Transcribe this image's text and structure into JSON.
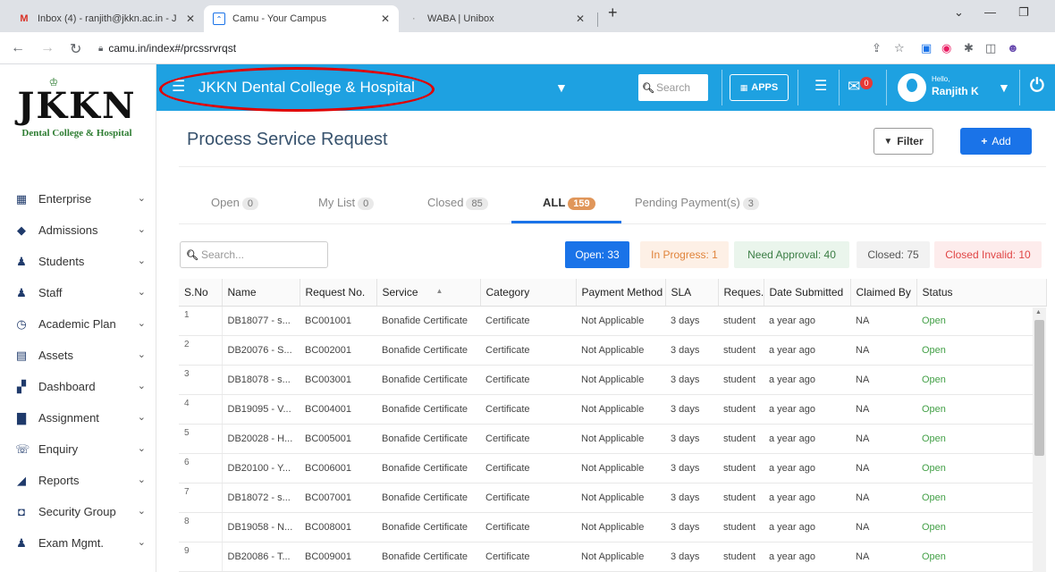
{
  "browser": {
    "tabs": [
      {
        "title": "Inbox (4) - ranjith@jkkn.ac.in - J",
        "icon": "gmail-icon"
      },
      {
        "title": "Camu - Your Campus",
        "icon": "camu-icon"
      },
      {
        "title": "WABA | Unibox",
        "icon": "waba-icon"
      }
    ],
    "url": "camu.in/index#/prcssrvrqst"
  },
  "header": {
    "college": "JKKN Dental College & Hospital",
    "search_placeholder": "Search",
    "apps_label": "APPS",
    "mail_badge": "0",
    "hello": "Hello,",
    "user": "Ranjith K"
  },
  "logo": {
    "text": "JKKN",
    "subtitle": "Dental College & Hospital"
  },
  "sidebar": {
    "items": [
      {
        "label": "Enterprise",
        "icon": "building-icon"
      },
      {
        "label": "Admissions",
        "icon": "admissions-icon"
      },
      {
        "label": "Students",
        "icon": "students-icon"
      },
      {
        "label": "Staff",
        "icon": "staff-icon"
      },
      {
        "label": "Academic Plan",
        "icon": "timer-icon"
      },
      {
        "label": "Assets",
        "icon": "assets-icon"
      },
      {
        "label": "Dashboard",
        "icon": "dashboard-icon"
      },
      {
        "label": "Assignment",
        "icon": "assignment-icon"
      },
      {
        "label": "Enquiry",
        "icon": "phone-icon"
      },
      {
        "label": "Reports",
        "icon": "chart-icon"
      },
      {
        "label": "Security Group",
        "icon": "shield-icon"
      },
      {
        "label": "Exam Mgmt.",
        "icon": "exam-icon"
      }
    ]
  },
  "page": {
    "title": "Process Service Request",
    "filter_label": "Filter",
    "add_label": "Add"
  },
  "tabs": [
    {
      "label": "Open",
      "count": "0"
    },
    {
      "label": "My List",
      "count": "0"
    },
    {
      "label": "Closed",
      "count": "85"
    },
    {
      "label": "ALL",
      "count": "159"
    },
    {
      "label": "Pending Payment(s)",
      "count": "3"
    }
  ],
  "table_search_placeholder": "Search...",
  "status_chips": [
    {
      "label": "Open: 33",
      "bg": "#1a73e8",
      "color": "#ffffff"
    },
    {
      "label": "In Progress: 1",
      "bg": "#fdf0e6",
      "color": "#e0833a"
    },
    {
      "label": "Need Approval: 40",
      "bg": "#eaf5ec",
      "color": "#3a7d44"
    },
    {
      "label": "Closed: 75",
      "bg": "#f2f2f2",
      "color": "#555555"
    },
    {
      "label": "Closed Invalid: 10",
      "bg": "#fdecec",
      "color": "#e04646"
    }
  ],
  "columns": [
    "S.No",
    "Name",
    "Request No.",
    "Service",
    "Category",
    "Payment Method",
    "SLA",
    "Reques...",
    "Date Submitted",
    "Claimed By",
    "Status"
  ],
  "rows": [
    [
      "1",
      "DB18077 - s...",
      "BC001001",
      "Bonafide Certificate",
      "Certificate",
      "Not Applicable",
      "3 days",
      "student",
      "a year ago",
      "NA",
      "Open"
    ],
    [
      "2",
      "DB20076 - S...",
      "BC002001",
      "Bonafide Certificate",
      "Certificate",
      "Not Applicable",
      "3 days",
      "student",
      "a year ago",
      "NA",
      "Open"
    ],
    [
      "3",
      "DB18078 - s...",
      "BC003001",
      "Bonafide Certificate",
      "Certificate",
      "Not Applicable",
      "3 days",
      "student",
      "a year ago",
      "NA",
      "Open"
    ],
    [
      "4",
      "DB19095 - V...",
      "BC004001",
      "Bonafide Certificate",
      "Certificate",
      "Not Applicable",
      "3 days",
      "student",
      "a year ago",
      "NA",
      "Open"
    ],
    [
      "5",
      "DB20028 - H...",
      "BC005001",
      "Bonafide Certificate",
      "Certificate",
      "Not Applicable",
      "3 days",
      "student",
      "a year ago",
      "NA",
      "Open"
    ],
    [
      "6",
      "DB20100 - Y...",
      "BC006001",
      "Bonafide Certificate",
      "Certificate",
      "Not Applicable",
      "3 days",
      "student",
      "a year ago",
      "NA",
      "Open"
    ],
    [
      "7",
      "DB18072 - s...",
      "BC007001",
      "Bonafide Certificate",
      "Certificate",
      "Not Applicable",
      "3 days",
      "student",
      "a year ago",
      "NA",
      "Open"
    ],
    [
      "8",
      "DB19058 - N...",
      "BC008001",
      "Bonafide Certificate",
      "Certificate",
      "Not Applicable",
      "3 days",
      "student",
      "a year ago",
      "NA",
      "Open"
    ],
    [
      "9",
      "DB20086 - T...",
      "BC009001",
      "Bonafide Certificate",
      "Certificate",
      "Not Applicable",
      "3 days",
      "student",
      "a year ago",
      "NA",
      "Open"
    ]
  ],
  "colors": {
    "header_bg": "#1ea1e1",
    "accent": "#1a73e8",
    "status_open": "#43a047",
    "annotation": "#e00000"
  }
}
